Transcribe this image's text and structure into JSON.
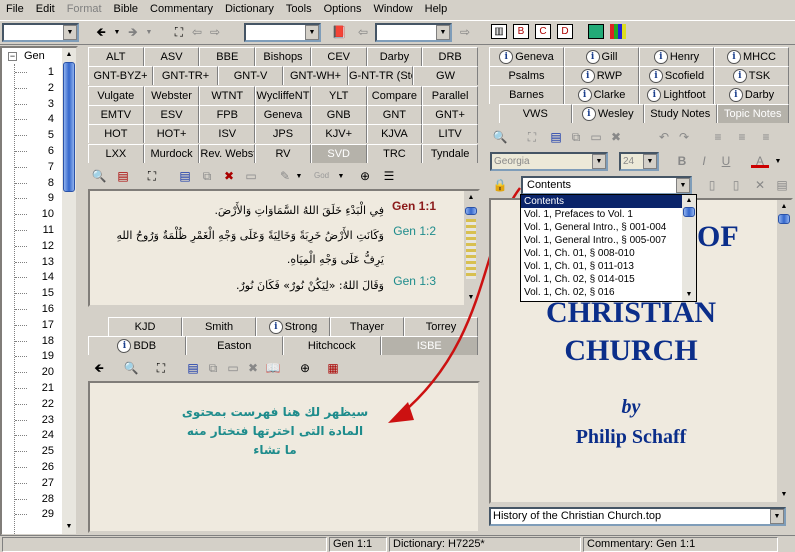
{
  "menu": {
    "items": [
      "File",
      "Edit",
      "Format",
      "Bible",
      "Commentary",
      "Dictionary",
      "Tools",
      "Options",
      "Window",
      "Help"
    ],
    "disabled_index": 2
  },
  "tree": {
    "root": "Gen",
    "items": [
      "1",
      "2",
      "3",
      "4",
      "5",
      "6",
      "7",
      "8",
      "9",
      "10",
      "11",
      "12",
      "13",
      "14",
      "15",
      "16",
      "17",
      "18",
      "19",
      "20",
      "21",
      "22",
      "23",
      "24",
      "25",
      "26",
      "27",
      "28",
      "29"
    ]
  },
  "bible_tabs": {
    "rows": [
      [
        "ALT",
        "ASV",
        "BBE",
        "Bishops",
        "CEV",
        "Darby",
        "DRB"
      ],
      [
        "GNT-BYZ+",
        "GNT-TR+",
        "GNT-V",
        "GNT-WH+",
        "G-NT-TR (Steph)+",
        "GW"
      ],
      [
        "Vulgate",
        "Webster",
        "WTNT",
        "WycliffeNT",
        "YLT",
        "Compare",
        "Parallel"
      ],
      [
        "EMTV",
        "ESV",
        "FPB",
        "Geneva",
        "GNB",
        "GNT",
        "GNT+"
      ],
      [
        "HOT",
        "HOT+",
        "ISV",
        "JPS",
        "KJV+",
        "KJVA",
        "LITV"
      ],
      [
        "LXX",
        "Murdock",
        "Rev. Webster+",
        "RV",
        "SVD",
        "TRC",
        "Tyndale"
      ]
    ],
    "selected": "SVD"
  },
  "bible_toolbar": {
    "god_label": "God"
  },
  "verses": [
    {
      "ref": "Gen 1:1",
      "text": "فِي الْبَدْءِ خَلَقَ اللهُ السَّمَاوَاتِ وَالأَرْضَ."
    },
    {
      "ref": "Gen 1:2",
      "text": "وَكَانَتِ الأَرْضُ خَرِبَةً وَخَالِيَةً وَعَلَى وَجْهِ الْغَمْرِ ظُلْمَةٌ وَرُوحُ اللهِ يَرِفُّ عَلَى وَجْهِ الْمِيَاهِ."
    },
    {
      "ref": "Gen 1:3",
      "text": "وَقَالَ اللهُ: «لِيَكُنْ نُورٌ» فَكَانَ نُورٌ."
    }
  ],
  "dict_tabs": {
    "row1": [
      "KJD",
      "Smith",
      "Strong",
      "Thayer",
      "Torrey"
    ],
    "row2": [
      "BDB",
      "Easton",
      "Hitchcock",
      "ISBE"
    ],
    "selected": "ISBE"
  },
  "annotation": {
    "lines": [
      "سيظهر لك هنا فهرست بمحتوى",
      "المادة التى اخترتها فتختار منه",
      "ما تشاء"
    ],
    "color": "#1e8c8c",
    "arrow_color": "#cc1111"
  },
  "comm_tabs": {
    "row1": [
      "Geneva",
      "Gill",
      "Henry",
      "MHCC"
    ],
    "row2": [
      "Psalms",
      "RWP",
      "Scofield",
      "TSK"
    ],
    "row3": [
      "Barnes",
      "Clarke",
      "Lightfoot",
      "Darby"
    ],
    "row4": [
      "VWS",
      "Wesley",
      "Study Notes",
      "Topic Notes"
    ],
    "selected": "Topic Notes"
  },
  "editor": {
    "font": "Georgia",
    "size": "24"
  },
  "contents": {
    "selected": "Contents",
    "options": [
      "Contents",
      "Vol. 1,   Prefaces to Vol. 1",
      "Vol. 1,   General Intro., § 001-004",
      "Vol. 1,   General Intro., § 005-007",
      "Vol. 1, Ch. 01, § 008-010",
      "Vol. 1, Ch. 01, § 011-013",
      "Vol. 1, Ch. 02, § 014-015",
      "Vol. 1, Ch. 02, § 016"
    ]
  },
  "book": {
    "title_partial": "OF",
    "title1": "CHRISTIAN",
    "title2": "CHURCH",
    "by": "by",
    "author": "Philip Schaff",
    "file": "History of the Christian Church.top",
    "title_color": "#0b2e8a"
  },
  "status": {
    "verse": "Gen 1:1",
    "dictionary": "Dictionary: H7225*",
    "commentary": "Commentary: Gen 1:1"
  }
}
